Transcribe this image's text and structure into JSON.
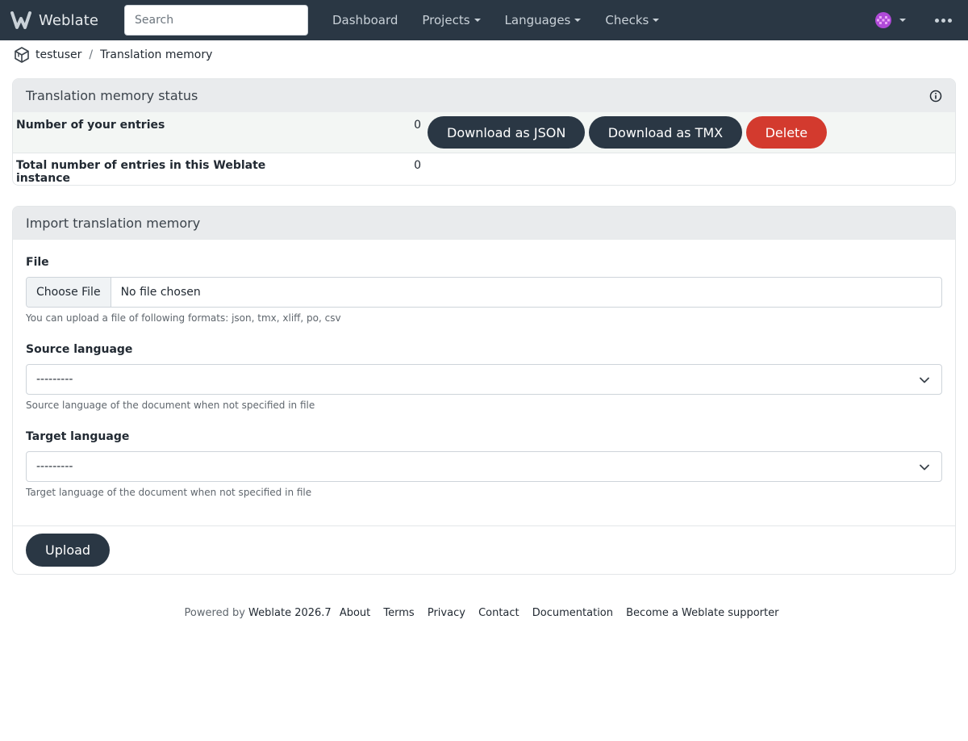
{
  "navbar": {
    "brand": "Weblate",
    "search_placeholder": "Search",
    "items": [
      {
        "label": "Dashboard",
        "dropdown": false
      },
      {
        "label": "Projects",
        "dropdown": true
      },
      {
        "label": "Languages",
        "dropdown": true
      },
      {
        "label": "Checks",
        "dropdown": true
      }
    ]
  },
  "breadcrumb": {
    "user": "testuser",
    "separator": "/",
    "current": "Translation memory"
  },
  "status_panel": {
    "title": "Translation memory status",
    "rows": [
      {
        "label": "Number of your entries",
        "value": "0"
      },
      {
        "label": "Total number of entries in this Weblate instance",
        "value": "0"
      }
    ],
    "buttons": {
      "json": "Download as JSON",
      "tmx": "Download as TMX",
      "delete": "Delete"
    }
  },
  "import_panel": {
    "title": "Import translation memory",
    "file_label": "File",
    "choose_file": "Choose File",
    "no_file": "No file chosen",
    "file_help": "You can upload a file of following formats: json, tmx, xliff, po, csv",
    "source_label": "Source language",
    "source_value": "---------",
    "source_help": "Source language of the document when not specified in file",
    "target_label": "Target language",
    "target_value": "---------",
    "target_help": "Target language of the document when not specified in file",
    "upload": "Upload"
  },
  "footer": {
    "powered_by": "Powered by",
    "version": "Weblate 2026.7",
    "links": [
      "About",
      "Terms",
      "Privacy",
      "Contact",
      "Documentation",
      "Become a Weblate supporter"
    ]
  },
  "colors": {
    "navbar_bg": "#2a3744",
    "primary_button": "#2a3744",
    "danger_button": "#d33a2e"
  }
}
